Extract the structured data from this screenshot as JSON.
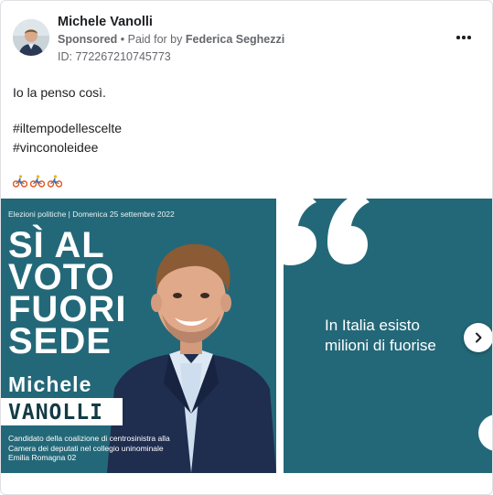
{
  "post": {
    "page_name": "Michele Vanolli",
    "sponsored_label": "Sponsored",
    "paid_for_prefix": " • Paid for by ",
    "payer": "Federica Seghezzi",
    "ad_id": "ID: 772267210745773",
    "text_line1": "Io la penso così.",
    "hashtag1": "#iltempodellescelte",
    "hashtag2": "#vinconoleidee",
    "emoji_icons": [
      "bicyclist-icon",
      "bicyclist-icon",
      "bicyclist-icon"
    ]
  },
  "carousel": {
    "slide1": {
      "header": "Elezioni politiche | Domenica 25 settembre 2022",
      "slogan": [
        "SÌ AL",
        "VOTO",
        "FUORI",
        "SEDE"
      ],
      "first_name": "Michele",
      "last_name": "VANOLLI",
      "description": [
        "Candidato della coalizione di centrosinistra alla",
        "Camera dei deputati nel collegio uninominale",
        "Emilia Romagna 02"
      ]
    },
    "slide2": {
      "text": [
        "In Italia esisto",
        "milioni di fuorise"
      ]
    },
    "next_icon": "chevron-right-icon"
  },
  "colors": {
    "slide_background": "#236878",
    "text_primary": "#1c1e21",
    "text_secondary": "#65676b"
  }
}
